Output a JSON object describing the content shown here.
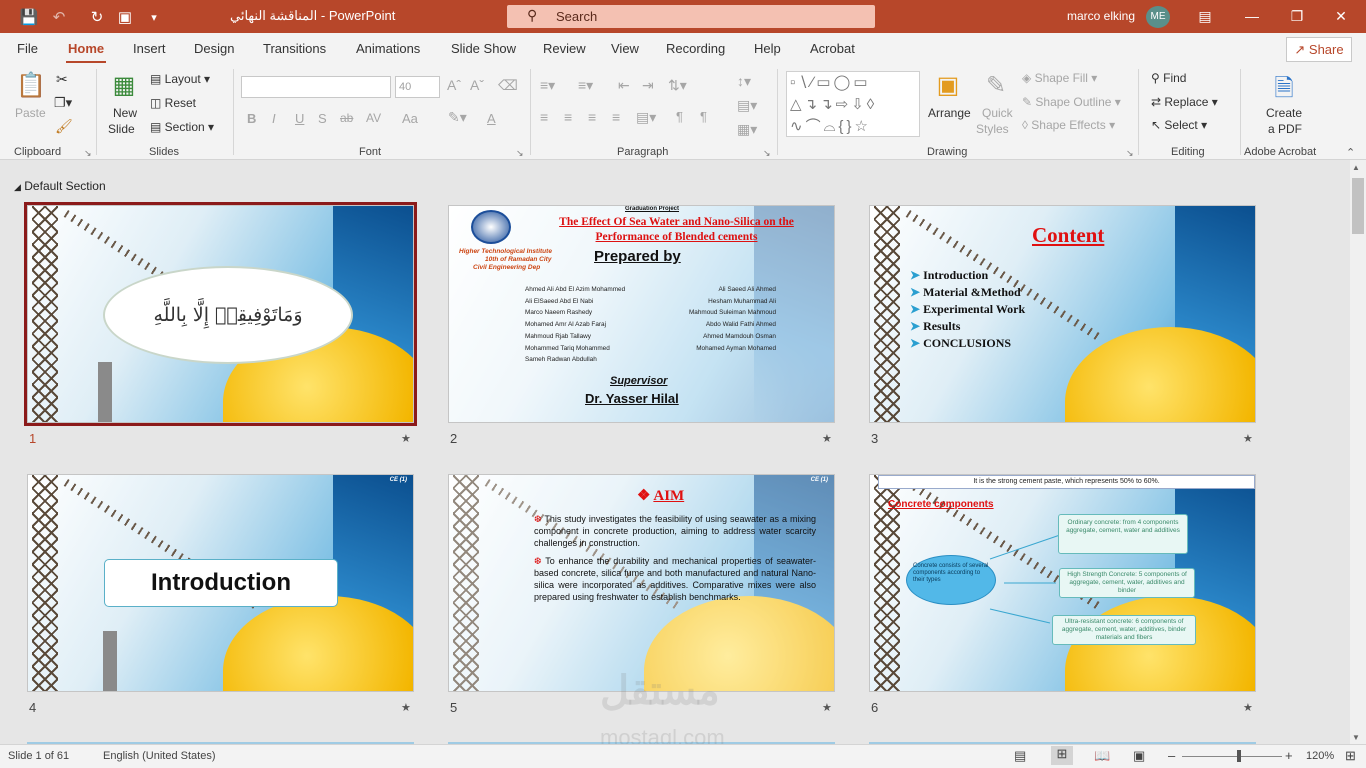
{
  "titlebar": {
    "doc_title": "المناقشة النهائي  -  PowerPoint",
    "search_placeholder": "Search",
    "user_name": "marco elking",
    "user_initials": "ME"
  },
  "menu": {
    "tabs": [
      "File",
      "Home",
      "Insert",
      "Design",
      "Transitions",
      "Animations",
      "Slide Show",
      "Review",
      "View",
      "Recording",
      "Help",
      "Acrobat"
    ],
    "share": "Share"
  },
  "ribbon": {
    "clipboard": {
      "paste": "Paste",
      "label": "Clipboard"
    },
    "slides": {
      "new_slide_1": "New",
      "new_slide_2": "Slide",
      "layout": "Layout",
      "reset": "Reset",
      "section": "Section",
      "label": "Slides"
    },
    "font": {
      "label": "Font",
      "size": "40",
      "buttons": [
        "B",
        "I",
        "U",
        "S",
        "ab",
        "AV",
        "Aa",
        "A"
      ]
    },
    "paragraph": {
      "label": "Paragraph"
    },
    "drawing": {
      "arrange": "Arrange",
      "quick_styles_1": "Quick",
      "quick_styles_2": "Styles",
      "shape_fill": "Shape Fill",
      "shape_outline": "Shape Outline",
      "shape_effects": "Shape Effects",
      "label": "Drawing"
    },
    "editing": {
      "find": "Find",
      "replace": "Replace",
      "select": "Select",
      "label": "Editing"
    },
    "acrobat": {
      "create_1": "Create",
      "create_2": "a PDF",
      "label": "Adobe Acrobat"
    }
  },
  "section_name": "Default Section",
  "slides": [
    {
      "num": "1",
      "arabic": "وَمَاتَوْفِيقِيۤ إِلَّا بِاللَّهِ"
    },
    {
      "num": "2",
      "header": "Graduation Project",
      "title1": "The Effect Of Sea Water and Nano-Silica on the",
      "title2": "Performance of Blended cements",
      "inst1": "Higher Technological Institute",
      "inst2": "10th of Ramadan City",
      "inst3": "Civil Engineering Dep",
      "prepared": "Prepared by",
      "left_names": [
        "Ahmed Ali Abd El Azim Mohammed",
        "Ali ElSaeed Abd El Nabi",
        "Marco Naeem Rashedy",
        "Mohamed Amr Al  Azab Faraj",
        "Mahmoud Rjab Tallawy",
        "Mohammed Tariq Mohammed",
        "Sameh Radwan Abdullah"
      ],
      "right_names": [
        "Ali Saeed Ali Ahmed",
        "Hesham Muhammad Ali",
        "Mahmoud Suleiman Mahmoud",
        "Abdo Walid Fathi Ahmed",
        "Ahmed Mamdouh Osman",
        "Mohamed Ayman Mohamed"
      ],
      "supervisor_label": "Supervisor",
      "supervisor": "Dr. Yasser Hilal"
    },
    {
      "num": "3",
      "title": "Content",
      "items": [
        "Introduction",
        "Material &Method",
        "Experimental Work",
        "Results",
        "CONCLUSIONS"
      ]
    },
    {
      "num": "4",
      "title": "Introduction",
      "tag": "CE (1)"
    },
    {
      "num": "5",
      "title": "AIM",
      "tag": "CE (1)",
      "p1": "This study investigates the feasibility of using seawater as a mixing component in concrete production, aiming to address water scarcity challenges in construction.",
      "p2": "To enhance the durability and mechanical properties of seawater-based concrete, silica fume and both manufactured and natural Nano-silica were incorporated as additives. Comparative mixes were also prepared using freshwater to establish benchmarks."
    },
    {
      "num": "6",
      "top": "It is the strong cement paste, which represents 50% to 60%.",
      "title": "Concrete components",
      "center": "Concrete consists of several components according to their types",
      "box1": "Ordinary concrete: from 4 components aggregate, cement, water and additives",
      "box2": "High Strength Concrete: 5 components of aggregate, cement, water, additives and binder",
      "box3": "Ultra-resistant concrete: 6 components of aggregate, cement, water, additives, binder materials and fibers"
    }
  ],
  "status": {
    "slide": "Slide 1 of 61",
    "language": "English (United States)",
    "zoom": "120%"
  },
  "watermark": {
    "ar": "مستقل",
    "en": "mostaql.com"
  }
}
